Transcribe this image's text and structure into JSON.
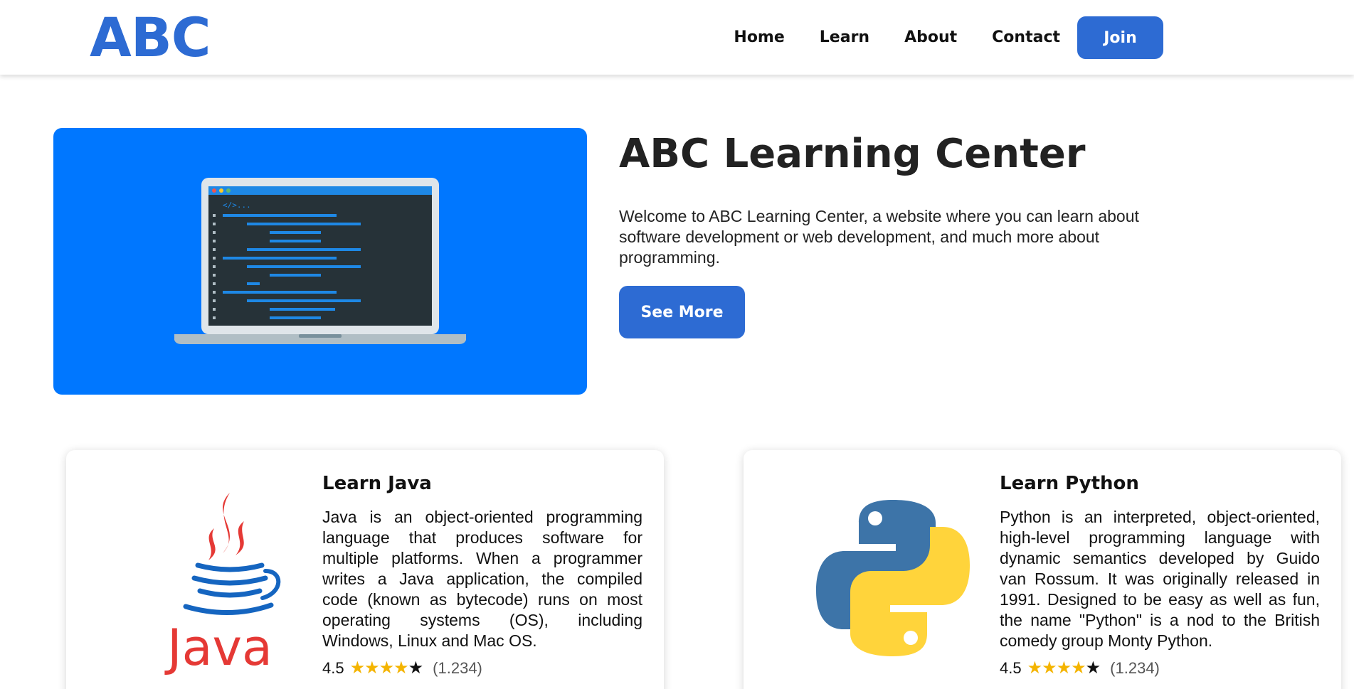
{
  "header": {
    "logo": "ABC",
    "nav": [
      "Home",
      "Learn",
      "About",
      "Contact"
    ],
    "join_label": "Join"
  },
  "hero": {
    "title": "ABC Learning Center",
    "text": "Welcome to ABC Learning Center, a website where you can learn about software development or web development, and much more about programming.",
    "button_label": "See More",
    "code_tag": "</>..."
  },
  "cards": [
    {
      "title": "Learn Java",
      "text": "Java is an object-oriented programming language that produces software for multiple platforms. When a programmer writes a Java application, the compiled code (known as bytecode) runs on most operating systems (OS), including Windows, Linux and Mac OS.",
      "rating": "4.5",
      "stars": 4.5,
      "count": "(1.234)",
      "logo_text": "Java"
    },
    {
      "title": "Learn Python",
      "text": "Python is an interpreted, object-oriented, high-level programming language with dynamic semantics developed by Guido van Rossum. It was originally released in 1991. Designed to be easy as well as fun, the name \"Python\" is a nod to the British comedy group Monty Python.",
      "rating": "4.5",
      "stars": 4.5,
      "count": "(1.234)"
    }
  ],
  "colors": {
    "accent": "#2d6bd3",
    "hero_bg": "#0077ff",
    "star": "#f4b400"
  },
  "icons": {
    "hero": "laptop-code-icon",
    "java": "java-logo",
    "python": "python-logo",
    "star": "star-icon"
  }
}
